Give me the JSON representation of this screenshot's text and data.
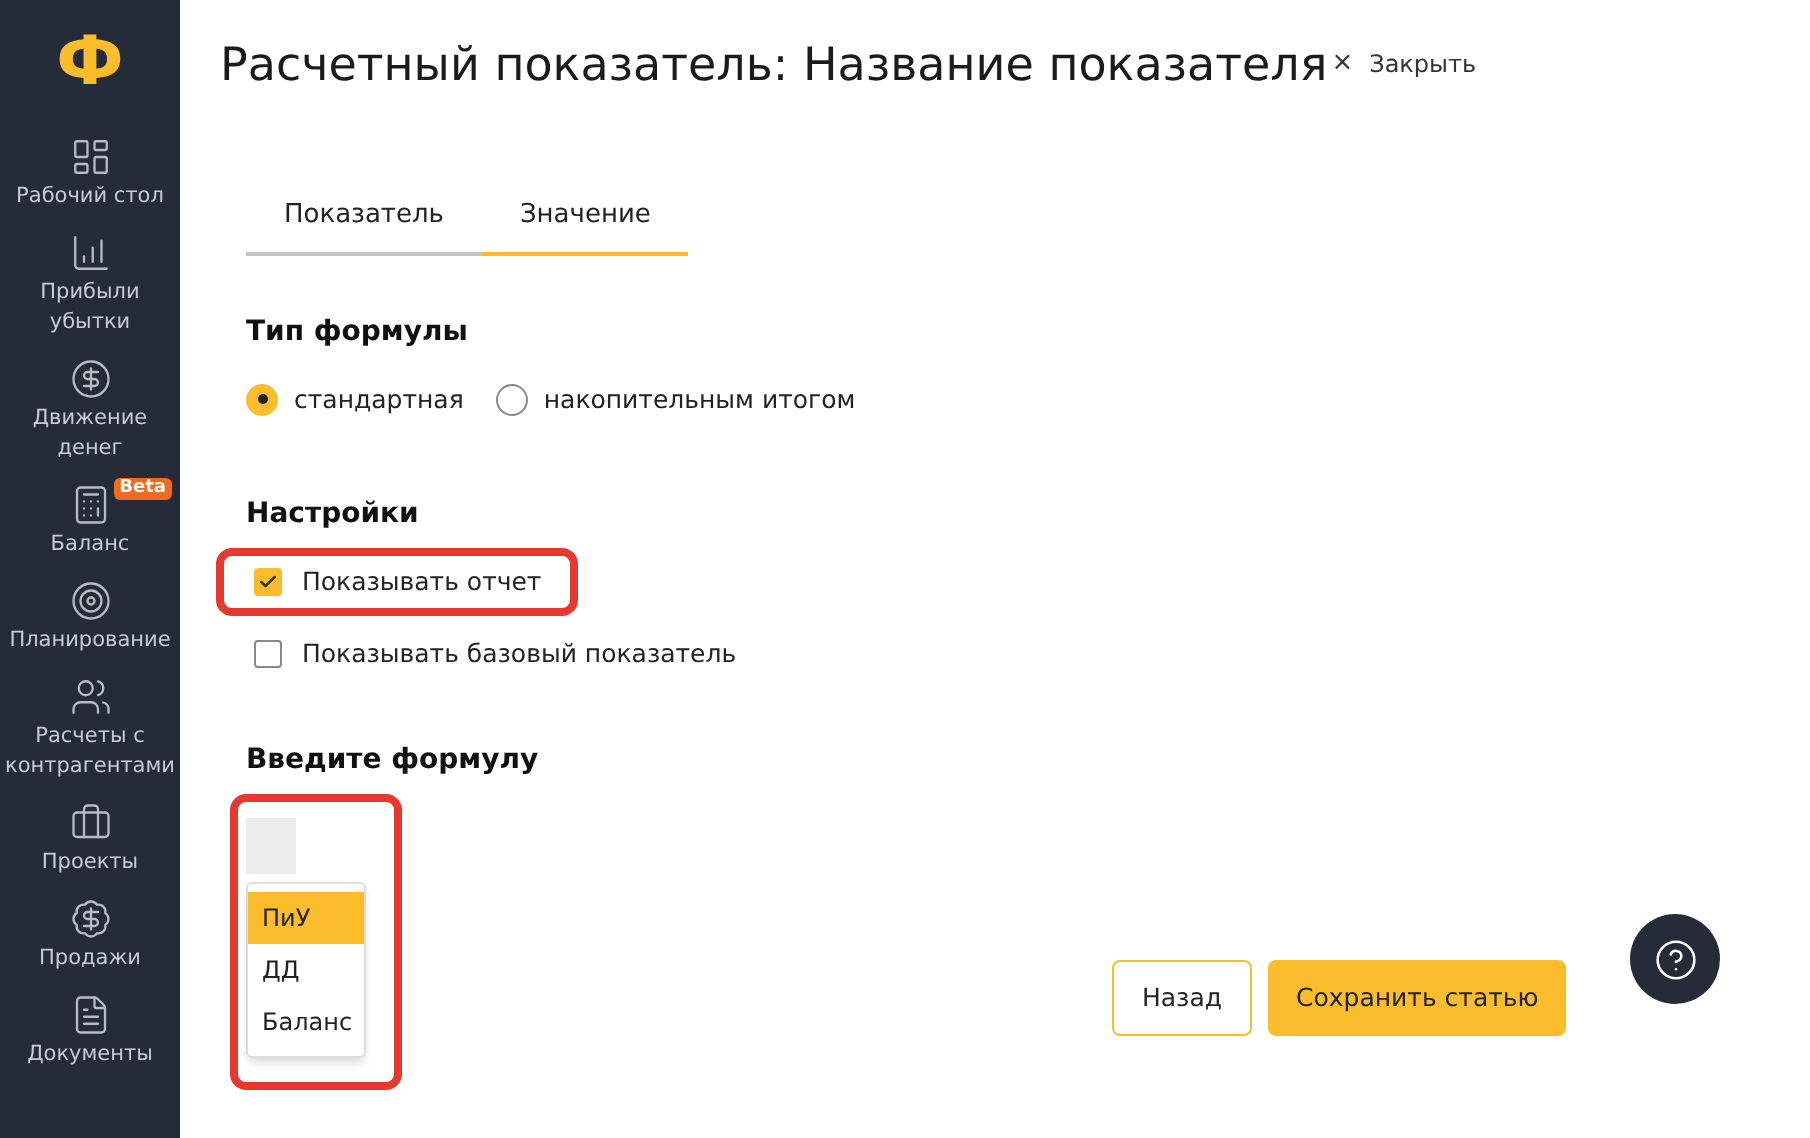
{
  "sidebar": {
    "logo": "Ф",
    "items": [
      {
        "label": "Рабочий стол"
      },
      {
        "label": "Прибыли убытки"
      },
      {
        "label": "Движение денег"
      },
      {
        "label": "Баланс",
        "badge": "Beta"
      },
      {
        "label": "Планирование"
      },
      {
        "label": "Расчеты с контрагентами"
      },
      {
        "label": "Проекты"
      },
      {
        "label": "Продажи"
      },
      {
        "label": "Документы"
      }
    ]
  },
  "header": {
    "title": "Расчетный показатель: Название показателя",
    "close_icon": "×",
    "close_label": "Закрыть"
  },
  "tabs": [
    {
      "label": "Показатель",
      "selected": false
    },
    {
      "label": "Значение",
      "selected": true
    }
  ],
  "formula_type": {
    "heading": "Тип формулы",
    "options": [
      {
        "label": "стандартная",
        "selected": true
      },
      {
        "label": "накопительным итогом",
        "selected": false
      }
    ]
  },
  "settings": {
    "heading": "Настройки",
    "options": [
      {
        "label": "Показывать отчет",
        "checked": true,
        "highlighted": true
      },
      {
        "label": "Показывать базовый показатель",
        "checked": false,
        "highlighted": false
      }
    ]
  },
  "formula": {
    "heading": "Введите формулу",
    "highlighted": true,
    "menu": [
      {
        "label": "ПиУ",
        "selected": true
      },
      {
        "label": "ДД",
        "selected": false
      },
      {
        "label": "Баланс",
        "selected": false
      }
    ]
  },
  "buttons": [
    {
      "label": "Назад",
      "kind": "secondary"
    },
    {
      "label": "Сохранить статью",
      "kind": "primary"
    }
  ]
}
